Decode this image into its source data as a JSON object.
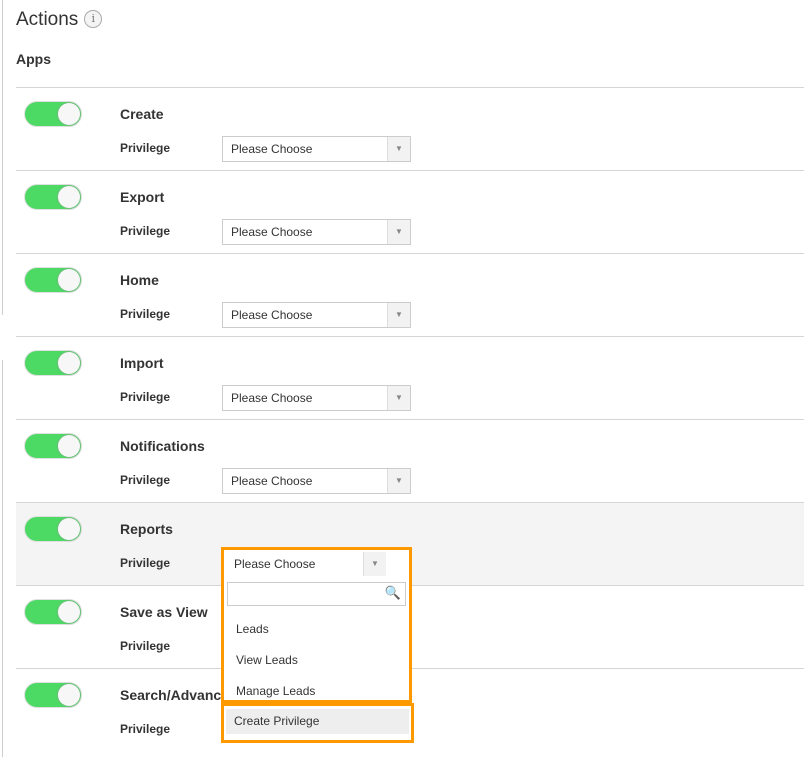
{
  "header": {
    "title": "Actions",
    "info_icon": "info-icon",
    "section": "Apps"
  },
  "rows": [
    {
      "name": "Create",
      "privilege_label": "Privilege",
      "select_value": "Please Choose",
      "enabled": true
    },
    {
      "name": "Export",
      "privilege_label": "Privilege",
      "select_value": "Please Choose",
      "enabled": true
    },
    {
      "name": "Home",
      "privilege_label": "Privilege",
      "select_value": "Please Choose",
      "enabled": true
    },
    {
      "name": "Import",
      "privilege_label": "Privilege",
      "select_value": "Please Choose",
      "enabled": true
    },
    {
      "name": "Notifications",
      "privilege_label": "Privilege",
      "select_value": "Please Choose",
      "enabled": true
    },
    {
      "name": "Reports",
      "privilege_label": "Privilege",
      "select_value": "Please Choose",
      "enabled": true
    },
    {
      "name": "Save as View",
      "privilege_label": "Privilege",
      "select_value": "",
      "enabled": true
    },
    {
      "name": "Search/Advanced",
      "privilege_label": "Privilege",
      "select_value": "",
      "enabled": true
    }
  ],
  "dropdown": {
    "value": "Please Choose",
    "search_value": "",
    "options": [
      "Leads",
      "View Leads",
      "Manage Leads"
    ],
    "create_label": "Create Privilege",
    "highlight_color": "#ff9900"
  },
  "colors": {
    "toggle_on": "#4cd964"
  }
}
